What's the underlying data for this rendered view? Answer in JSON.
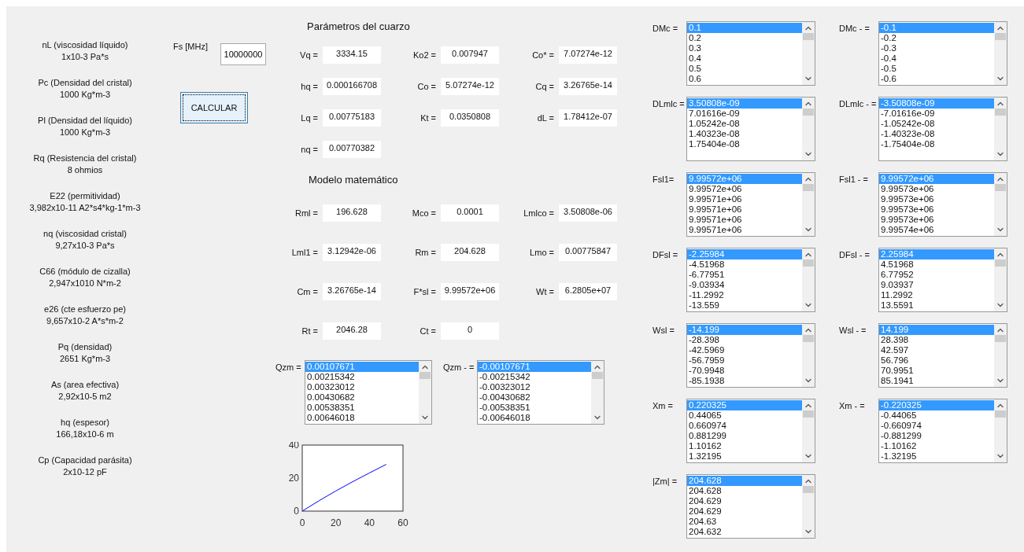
{
  "parameters": [
    {
      "name": "nL (viscosidad líquido)",
      "value": "1x10-3 Pa*s"
    },
    {
      "name": "Pc (Densidad del cristal)",
      "value": "1000 Kg*m-3"
    },
    {
      "name": "Pl (Densidad del líquido)",
      "value": "1000 Kg*m-3"
    },
    {
      "name": "Rq (Resistencia del cristal)",
      "value": "8 ohmios"
    },
    {
      "name": "E22 (permitividad)",
      "value": "3,982x10-11 A2*s4*kg-1*m-3"
    },
    {
      "name": "nq (viscosidad cristal)",
      "value": "9,27x10-3 Pa*s"
    },
    {
      "name": "C66 (módulo de cizalla)",
      "value": "2,947x1010 N*m-2"
    },
    {
      "name": "e26 (cte esfuerzo pe)",
      "value": "9,657x10-2 A*s*m-2"
    },
    {
      "name": "Pq (densidad)",
      "value": "2651 Kg*m-3"
    },
    {
      "name": "As (area efectiva)",
      "value": "2,92x10-5 m2"
    },
    {
      "name": "hq (espesor)",
      "value": "166,18x10-6 m"
    },
    {
      "name": "Cp (Capacidad parásita)",
      "value": "2x10-12 pF"
    }
  ],
  "frequency": {
    "label": "Fs [MHz]",
    "value": "10000000"
  },
  "calculate_button": {
    "label": "CALCULAR",
    "focused": true
  },
  "quartz": {
    "title": "Parámetros del cuarzo",
    "rows": [
      [
        {
          "label": "Vq =",
          "value": "3334.15"
        },
        {
          "label": "Ko2 =",
          "value": "0.007947"
        },
        {
          "label": "Co* =",
          "value": "7.07274e-12"
        }
      ],
      [
        {
          "label": "hq =",
          "value": "0.000166708"
        },
        {
          "label": "Co =",
          "value": "5.07274e-12"
        },
        {
          "label": "Cq =",
          "value": "3.26765e-14"
        }
      ],
      [
        {
          "label": "Lq =",
          "value": "0.00775183"
        },
        {
          "label": "Kt =",
          "value": "0.0350808"
        },
        {
          "label": "dL =",
          "value": "1.78412e-07"
        }
      ],
      [
        {
          "label": "nq =",
          "value": "0.00770382"
        }
      ]
    ]
  },
  "model": {
    "title": "Modelo matemático",
    "rows": [
      [
        {
          "label": "Rml =",
          "value": "196.628"
        },
        {
          "label": "Mco =",
          "value": "0.0001"
        },
        {
          "label": "Lmlco =",
          "value": "3.50808e-06"
        }
      ],
      [
        {
          "label": "Lml1 =",
          "value": "3.12942e-06"
        },
        {
          "label": "Rm =",
          "value": "204.628"
        },
        {
          "label": "Lmo =",
          "value": "0.00775847"
        }
      ],
      [
        {
          "label": "Cm =",
          "value": "3.26765e-14"
        },
        {
          "label": "F*sl =",
          "value": "9.99572e+06"
        },
        {
          "label": "Wt =",
          "value": "6.2805e+07"
        }
      ],
      [
        {
          "label": "Rt =",
          "value": "2046.28"
        },
        {
          "label": "Ct =",
          "value": "0"
        }
      ]
    ]
  },
  "q_lists": [
    {
      "label": "Qzm =",
      "items": [
        {
          "text": "0.00107671",
          "selected": true
        },
        {
          "text": "0.00215342",
          "selected": false
        },
        {
          "text": "0.00323012",
          "selected": false
        },
        {
          "text": "0.00430682",
          "selected": false
        },
        {
          "text": "0.00538351",
          "selected": false
        },
        {
          "text": "0.00646018",
          "selected": false
        }
      ]
    },
    {
      "label": "Qzm - =",
      "items": [
        {
          "text": "-0.00107671",
          "selected": true
        },
        {
          "text": "-0.00215342",
          "selected": false
        },
        {
          "text": "-0.00323012",
          "selected": false
        },
        {
          "text": "-0.00430682",
          "selected": false
        },
        {
          "text": "-0.00538351",
          "selected": false
        },
        {
          "text": "-0.00646018",
          "selected": false
        }
      ]
    }
  ],
  "chart": {
    "chart_data": {
      "type": "line",
      "x": [
        0,
        10,
        20,
        30,
        40,
        50
      ],
      "series": [
        {
          "color": "#0000ff",
          "values": [
            0,
            6.3,
            12.2,
            17.8,
            23.1,
            28.3
          ]
        }
      ],
      "xlim": [
        0,
        60
      ],
      "ylim": [
        0,
        40
      ],
      "xticks": [
        0,
        20,
        40,
        60
      ],
      "yticks": [
        0,
        20,
        40
      ]
    }
  },
  "list_columns": [
    [
      {
        "label": "DMc =",
        "items": [
          {
            "text": "0.1",
            "selected": true
          },
          {
            "text": "0.2",
            "selected": false
          },
          {
            "text": "0.3",
            "selected": false
          },
          {
            "text": "0.4",
            "selected": false
          },
          {
            "text": "0.5",
            "selected": false
          },
          {
            "text": "0.6",
            "selected": false
          }
        ]
      },
      {
        "label": "DLmlc =",
        "items": [
          {
            "text": "3.50808e-09",
            "selected": true
          },
          {
            "text": "7.01616e-09",
            "selected": false
          },
          {
            "text": "1.05242e-08",
            "selected": false
          },
          {
            "text": "1.40323e-08",
            "selected": false
          },
          {
            "text": "1.75404e-08",
            "selected": false
          }
        ]
      },
      {
        "label": "Fsl1=",
        "items": [
          {
            "text": "9.99572e+06",
            "selected": true
          },
          {
            "text": "9.99572e+06",
            "selected": false
          },
          {
            "text": "9.99571e+06",
            "selected": false
          },
          {
            "text": "9.99571e+06",
            "selected": false
          },
          {
            "text": "9.99571e+06",
            "selected": false
          },
          {
            "text": "9.99571e+06",
            "selected": false
          }
        ]
      },
      {
        "label": "DFsl =",
        "items": [
          {
            "text": "-2.25984",
            "selected": true
          },
          {
            "text": "-4.51968",
            "selected": false
          },
          {
            "text": "-6.77951",
            "selected": false
          },
          {
            "text": "-9.03934",
            "selected": false
          },
          {
            "text": "-11.2992",
            "selected": false
          },
          {
            "text": "-13.559",
            "selected": false
          }
        ]
      },
      {
        "label": "Wsl =",
        "items": [
          {
            "text": "-14.199",
            "selected": true
          },
          {
            "text": "-28.398",
            "selected": false
          },
          {
            "text": "-42.5969",
            "selected": false
          },
          {
            "text": "-56.7959",
            "selected": false
          },
          {
            "text": "-70.9948",
            "selected": false
          },
          {
            "text": "-85.1938",
            "selected": false
          }
        ]
      },
      {
        "label": "Xm =",
        "items": [
          {
            "text": "0.220325",
            "selected": true
          },
          {
            "text": "0.44065",
            "selected": false
          },
          {
            "text": "0.660974",
            "selected": false
          },
          {
            "text": "0.881299",
            "selected": false
          },
          {
            "text": "1.10162",
            "selected": false
          },
          {
            "text": "1.32195",
            "selected": false
          }
        ]
      },
      {
        "label": "|Zm| =",
        "items": [
          {
            "text": "204.628",
            "selected": true
          },
          {
            "text": "204.628",
            "selected": false
          },
          {
            "text": "204.629",
            "selected": false
          },
          {
            "text": "204.629",
            "selected": false
          },
          {
            "text": "204.63",
            "selected": false
          },
          {
            "text": "204.632",
            "selected": false
          }
        ]
      }
    ],
    [
      {
        "label": "DMc - =",
        "items": [
          {
            "text": "-0.1",
            "selected": true
          },
          {
            "text": "-0.2",
            "selected": false
          },
          {
            "text": "-0.3",
            "selected": false
          },
          {
            "text": "-0.4",
            "selected": false
          },
          {
            "text": "-0.5",
            "selected": false
          },
          {
            "text": "-0.6",
            "selected": false
          }
        ]
      },
      {
        "label": "DLmlc - =",
        "items": [
          {
            "text": "-3.50808e-09",
            "selected": true
          },
          {
            "text": "-7.01616e-09",
            "selected": false
          },
          {
            "text": "-1.05242e-08",
            "selected": false
          },
          {
            "text": "-1.40323e-08",
            "selected": false
          },
          {
            "text": "-1.75404e-08",
            "selected": false
          }
        ]
      },
      {
        "label": "Fsl1 - =",
        "items": [
          {
            "text": "9.99572e+06",
            "selected": true
          },
          {
            "text": "9.99573e+06",
            "selected": false
          },
          {
            "text": "9.99573e+06",
            "selected": false
          },
          {
            "text": "9.99573e+06",
            "selected": false
          },
          {
            "text": "9.99573e+06",
            "selected": false
          },
          {
            "text": "9.99574e+06",
            "selected": false
          }
        ]
      },
      {
        "label": "DFsl - =",
        "items": [
          {
            "text": "2.25984",
            "selected": true
          },
          {
            "text": "4.51968",
            "selected": false
          },
          {
            "text": "6.77952",
            "selected": false
          },
          {
            "text": "9.03937",
            "selected": false
          },
          {
            "text": "11.2992",
            "selected": false
          },
          {
            "text": "13.5591",
            "selected": false
          }
        ]
      },
      {
        "label": "Wsl - =",
        "items": [
          {
            "text": "14.199",
            "selected": true
          },
          {
            "text": "28.398",
            "selected": false
          },
          {
            "text": "42.597",
            "selected": false
          },
          {
            "text": "56.796",
            "selected": false
          },
          {
            "text": "70.9951",
            "selected": false
          },
          {
            "text": "85.1941",
            "selected": false
          }
        ]
      },
      {
        "label": "Xm - =",
        "items": [
          {
            "text": "-0.220325",
            "selected": true
          },
          {
            "text": "-0.44065",
            "selected": false
          },
          {
            "text": "-0.660974",
            "selected": false
          },
          {
            "text": "-0.881299",
            "selected": false
          },
          {
            "text": "-1.10162",
            "selected": false
          },
          {
            "text": "-1.32195",
            "selected": false
          }
        ]
      }
    ]
  ]
}
